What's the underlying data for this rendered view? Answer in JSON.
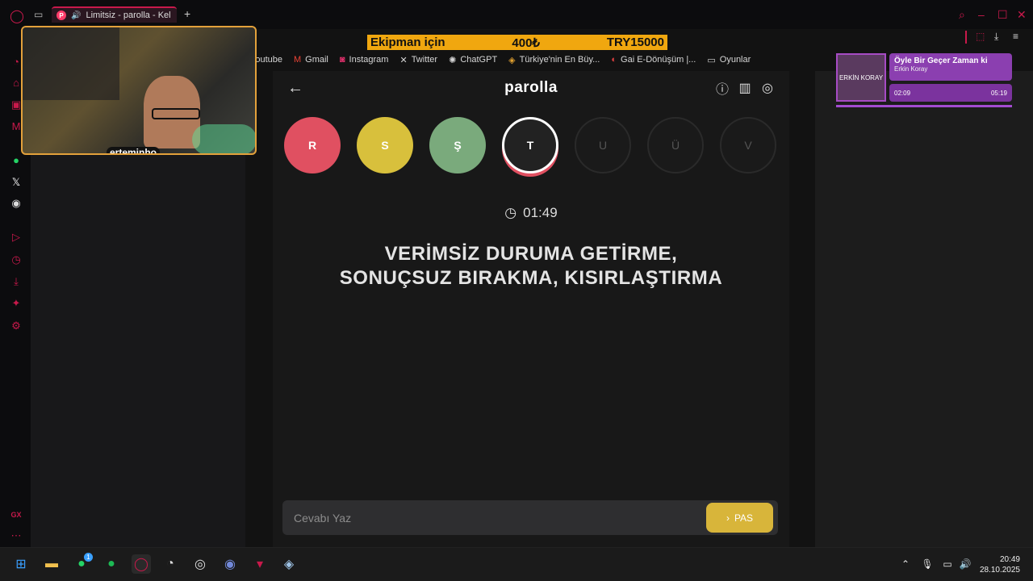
{
  "browser": {
    "tab_title": "Limitsiz - parolla - Kel",
    "tab_favicon": "P",
    "new_tab": "+",
    "bookmarks": [
      {
        "label": "Youtube",
        "icon": "youtube-icon"
      },
      {
        "label": "Gmail",
        "icon": "gmail-icon"
      },
      {
        "label": "Instagram",
        "icon": "instagram-icon"
      },
      {
        "label": "Twitter",
        "icon": "x-icon"
      },
      {
        "label": "ChatGPT",
        "icon": "chatgpt-icon"
      },
      {
        "label": "Türkiye'nin En Büy...",
        "icon": "site-icon"
      },
      {
        "label": "Gai E-Dönüşüm |...",
        "icon": "site-icon"
      },
      {
        "label": "Oyunlar",
        "icon": "folder-icon"
      }
    ]
  },
  "promo": {
    "left": "Ekipman için",
    "middle": "400₺",
    "right": "TRY15000"
  },
  "webcam": {
    "name": "erteminho"
  },
  "game": {
    "title": "parolla",
    "letters": [
      {
        "char": "R",
        "color": "#e05061",
        "state": "wrong"
      },
      {
        "char": "S",
        "color": "#d8c03c",
        "state": "passed"
      },
      {
        "char": "Ş",
        "color": "#7aaa7c",
        "state": "correct"
      },
      {
        "char": "T",
        "color": "#222222",
        "state": "current"
      },
      {
        "char": "U",
        "color": "#1a1a1a",
        "state": "pending"
      },
      {
        "char": "Ü",
        "color": "#1a1a1a",
        "state": "pending"
      },
      {
        "char": "V",
        "color": "#1a1a1a",
        "state": "pending"
      }
    ],
    "timer": "01:49",
    "question_line1": "VERİMSİZ DURUMA GETİRME,",
    "question_line2": "SONUÇSUZ BIRAKMA, KISIRLAŞTIRMA",
    "answer_placeholder": "Cevabı Yaz",
    "pass_label": "PAS"
  },
  "music": {
    "title": "Öyle Bir Geçer Zaman ki",
    "artist": "Erkin Koray",
    "album_text": "ERKİN KORAY",
    "elapsed": "02:09",
    "duration": "05:19"
  },
  "taskbar": {
    "time": "20:49",
    "date": "28.10.2025",
    "whatsapp_badge": "1"
  },
  "sidebar_bottom_label": "GX",
  "colors": {
    "accent": "#c8194b",
    "pass_button": "#d8b53a"
  }
}
